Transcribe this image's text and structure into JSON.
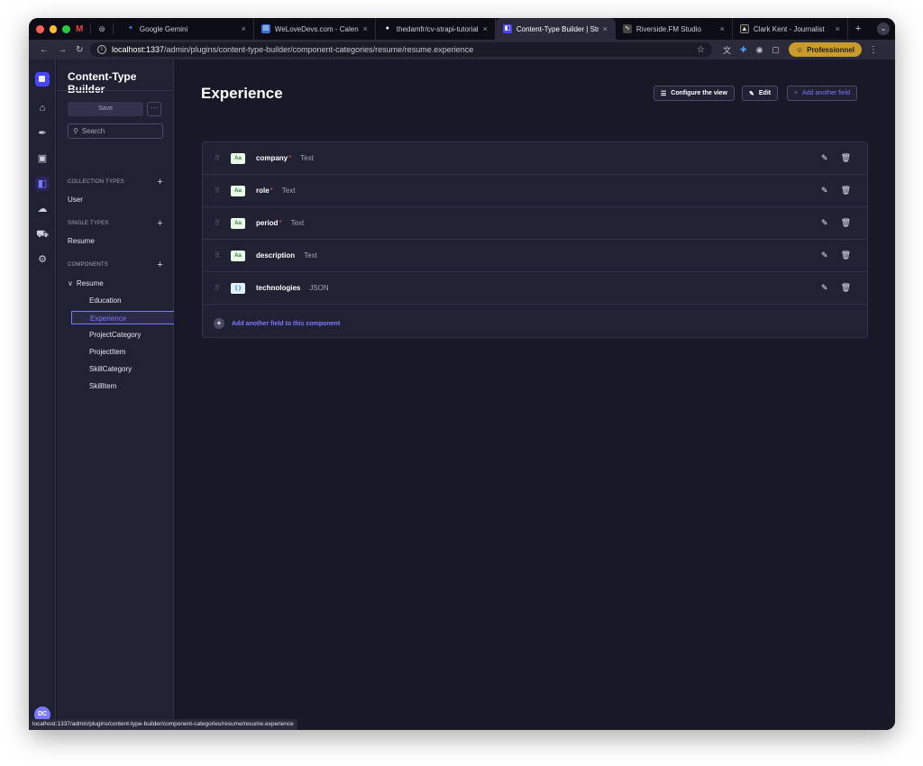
{
  "browser": {
    "pinned": [
      {
        "icon": "gmail-icon",
        "glyph": "M"
      },
      {
        "icon": "openai-icon",
        "glyph": "⊛"
      }
    ],
    "tabs": [
      {
        "title": "Google Gemini",
        "close": "×",
        "favicon_color": "#4a8df8",
        "glyph": "✦"
      },
      {
        "title": "WeLoveDevs.com - Calendar",
        "close": "×",
        "favicon_color": "#3b6fd8",
        "glyph": "▤"
      },
      {
        "title": "thedamfr/cv-strapi-tutorial at",
        "close": "×",
        "favicon_color": "#ffffff",
        "glyph": "●"
      },
      {
        "title": "Content-Type Builder | Strapi",
        "close": "×",
        "favicon_color": "#4945ff",
        "glyph": "◧",
        "active": true
      },
      {
        "title": "Riverside.FM Studio",
        "close": "×",
        "favicon_color": "#444444",
        "glyph": "∿"
      },
      {
        "title": "Clark Kent - Journalist",
        "close": "×",
        "favicon_color": "#222222",
        "glyph": "▲"
      }
    ],
    "new_tab": "+",
    "tab_menu": "⌄",
    "nav": {
      "back": "←",
      "forward": "→",
      "reload": "↻"
    },
    "url_host": "localhost:1337",
    "url_path": "/admin/plugins/content-type-builder/component-categories/resume/resume.experience",
    "bookmark": "☆",
    "profile": "Professionnel",
    "status_url": "localhost:1337/admin/plugins/content-type-builder/component-categories/resume/resume.experience"
  },
  "iconnav": {
    "avatar": "DC"
  },
  "subnav": {
    "title": "Content-Type Builder",
    "save_label": "Save",
    "more_label": "···",
    "search_placeholder": "Search",
    "sections": {
      "collection": {
        "label": "COLLECTION TYPES",
        "items": [
          "User"
        ]
      },
      "single": {
        "label": "SINGLE TYPES",
        "items": [
          "Resume"
        ]
      },
      "components": {
        "label": "COMPONENTS",
        "group": "Resume",
        "items": [
          "Education",
          "Experience",
          "ProjectCategory",
          "ProjectItem",
          "SkillCategory",
          "SkillItem"
        ]
      }
    }
  },
  "main": {
    "title": "Experience",
    "buttons": {
      "configure": "Configure the view",
      "edit": "Edit",
      "add_another": "Add another field"
    },
    "fields": [
      {
        "name": "company",
        "required": true,
        "type": "Text",
        "badge": "Aa",
        "kind": "text"
      },
      {
        "name": "role",
        "required": true,
        "type": "Text",
        "badge": "Aa",
        "kind": "text"
      },
      {
        "name": "period",
        "required": true,
        "type": "Text",
        "badge": "Aa",
        "kind": "text"
      },
      {
        "name": "description",
        "required": false,
        "type": "Text",
        "badge": "Aa",
        "kind": "text"
      },
      {
        "name": "technologies",
        "required": false,
        "type": "JSON",
        "badge": "{ }",
        "kind": "json"
      }
    ],
    "required_mark": "*",
    "add_to_component": "Add another field to this component"
  }
}
